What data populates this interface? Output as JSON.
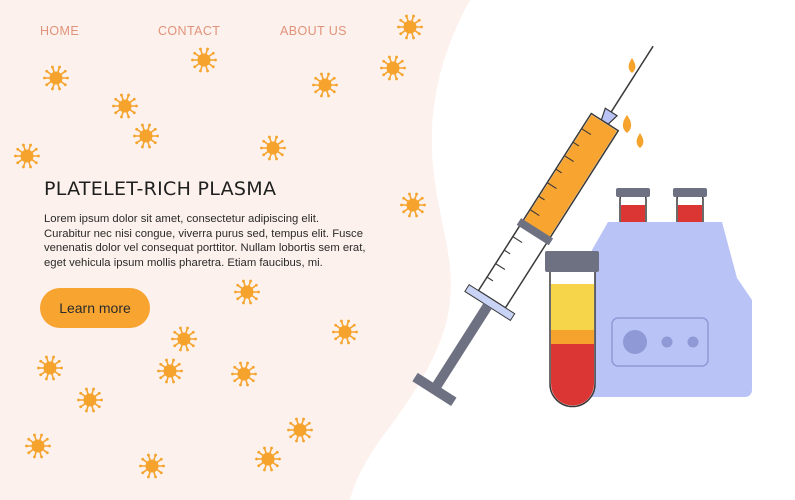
{
  "nav": {
    "items": [
      "HOME",
      "CONTACT",
      "ABOUT US"
    ]
  },
  "hero": {
    "title": "PLATELET-RICH PLASMA",
    "body": "Lorem ipsum dolor sit amet, consectetur adipiscing elit. Curabitur nec nisi congue, viverra purus sed, tempus elit. Fusce venenatis dolor vel consequat porttitor. Nullam lobortis sem erat, eget vehicula ipsum mollis pharetra. Etiam faucibus, mi.",
    "cta_label": "Learn more"
  },
  "colors": {
    "panel_bg": "#fcf1ec",
    "nav_text": "#e0937a",
    "accent": "#f7a431",
    "virus": "#f5a32c",
    "device": "#b9c3f6",
    "blood": "#db3534",
    "plasma": "#f7d54a"
  },
  "icons": [
    "virus-icon",
    "syringe-icon",
    "test-tube-icon",
    "centrifuge-icon",
    "drop-icon"
  ]
}
